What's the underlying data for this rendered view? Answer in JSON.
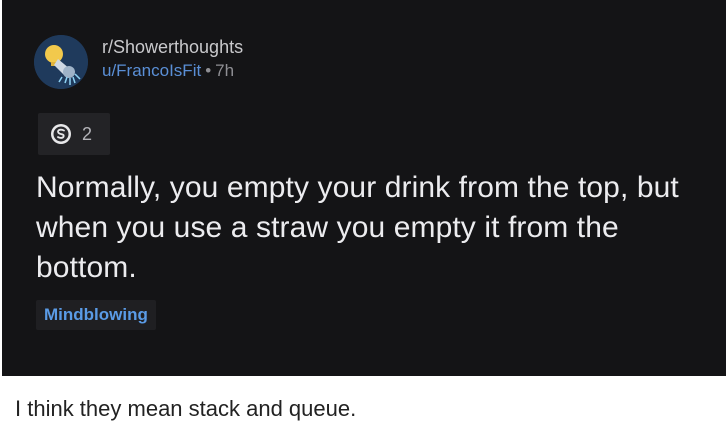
{
  "post": {
    "subreddit": "r/Showerthoughts",
    "author": "u/FrancoIsFit",
    "separator": "•",
    "age": "7h",
    "award": {
      "icon": "silver-award-icon",
      "count": "2"
    },
    "title": "Normally, you empty your drink from the top, but when you use a straw you empty it from the bottom.",
    "flair": "Mindblowing",
    "avatar_icon": "showerhead-lightbulb-icon"
  },
  "caption": "I think they mean stack and queue.",
  "colors": {
    "card_background": "#141416",
    "username": "#5a8fd6",
    "flair_text": "#5a9be6",
    "title_text": "#ececef"
  }
}
